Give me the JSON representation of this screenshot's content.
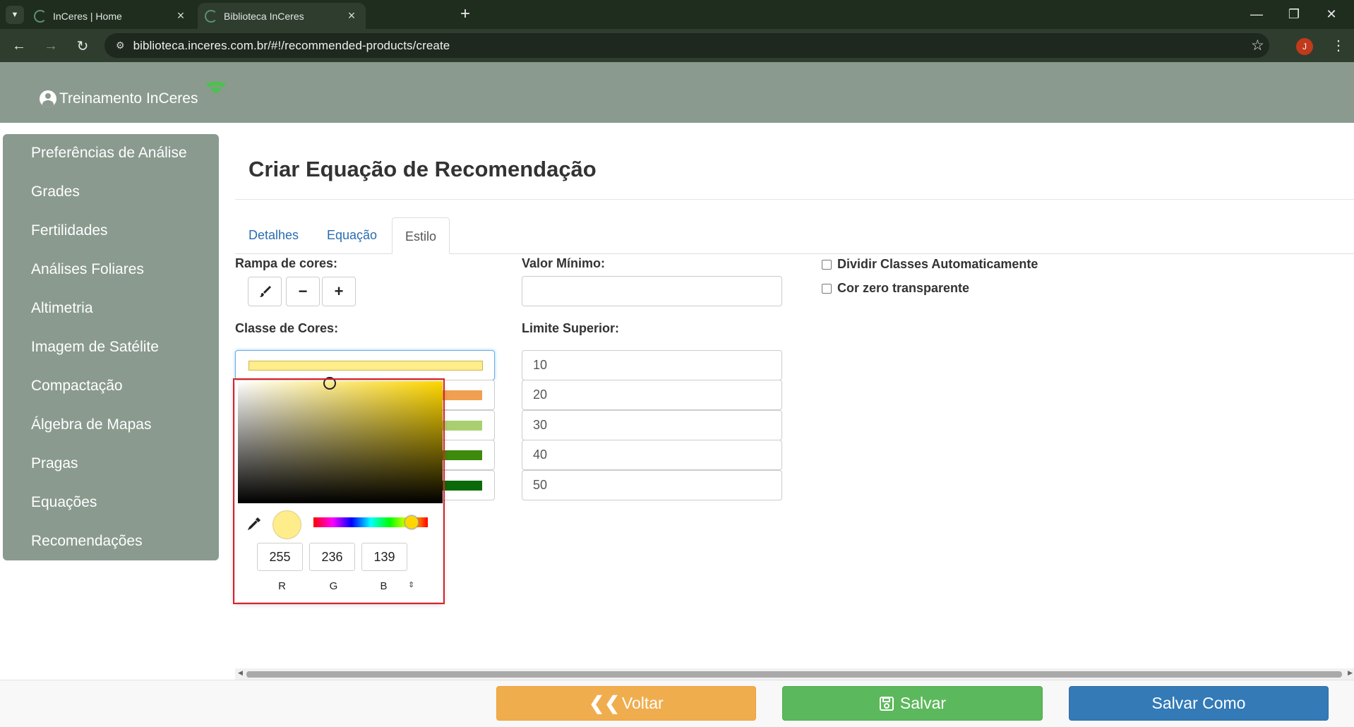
{
  "browser": {
    "tabs": [
      {
        "title": "InCeres | Home",
        "active": false
      },
      {
        "title": "Biblioteca InCeres",
        "active": true
      }
    ],
    "url": "biblioteca.inceres.com.br/#!/recommended-products/create",
    "profile_initial": "J"
  },
  "header": {
    "user_name": "Treinamento InCeres"
  },
  "sidebar": {
    "items": [
      {
        "label": "Preferências de Análise"
      },
      {
        "label": "Grades"
      },
      {
        "label": "Fertilidades"
      },
      {
        "label": "Análises Foliares"
      },
      {
        "label": "Altimetria"
      },
      {
        "label": "Imagem de Satélite"
      },
      {
        "label": "Compactação"
      },
      {
        "label": "Álgebra de Mapas"
      },
      {
        "label": "Pragas"
      },
      {
        "label": "Equações"
      },
      {
        "label": "Recomendações"
      }
    ]
  },
  "main": {
    "title": "Criar Equação de Recomendação",
    "tabs": [
      {
        "label": "Detalhes"
      },
      {
        "label": "Equação"
      },
      {
        "label": "Estilo",
        "active": true
      }
    ],
    "color_ramp_label": "Rampa de cores:",
    "color_classes_label": "Classe de Cores:",
    "color_classes": [
      "#ffec8b",
      "#f0a050",
      "#a8d070",
      "#3d8a0c",
      "#0a6a0a"
    ],
    "min_value_label": "Valor Mínimo:",
    "min_value": "",
    "upper_limit_label": "Limite Superior:",
    "upper_limits": [
      "10",
      "20",
      "30",
      "40",
      "50"
    ],
    "auto_classes_label": "Dividir Classes Automaticamente",
    "zero_transparent_label": "Cor zero transparente"
  },
  "color_picker": {
    "r": "255",
    "g": "236",
    "b": "139",
    "r_label": "R",
    "g_label": "G",
    "b_label": "B",
    "selected_color": "#ffec8b"
  },
  "footer": {
    "back_label": "Voltar",
    "save_label": "Salvar",
    "save_as_label": "Salvar Como"
  },
  "colors": {
    "header_bg": "#8a9a8f",
    "back_button": "#f0ad4e",
    "save_button": "#5cb85c",
    "save_as_button": "#337ab7",
    "highlight_outline": "#e0202a"
  }
}
